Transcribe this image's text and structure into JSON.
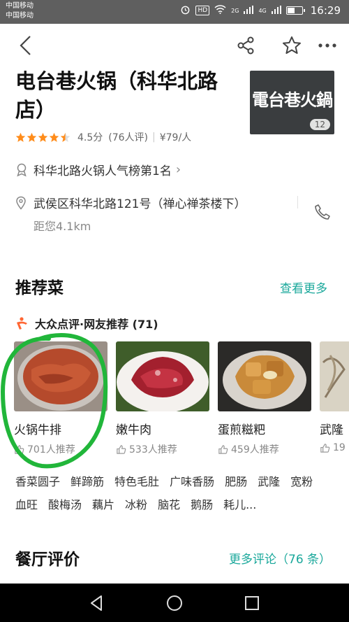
{
  "status": {
    "carrier_1": "中国移动",
    "carrier_2": "中国移动",
    "hd": "HD",
    "net_1": "2G",
    "net_2": "4G",
    "time": "16:29",
    "battery_level": 0.55
  },
  "nav": {
    "icons": [
      "back-arrow-icon",
      "share-icon",
      "star-outline-icon",
      "more-icon"
    ]
  },
  "shop": {
    "name": "电台巷火锅（科华北路店）",
    "thumb_text": "電台巷火鍋",
    "photo_count": "12",
    "star_rating": 4.5,
    "score": "4.5分",
    "reviews": "(76人评)",
    "price": "¥79/人",
    "rank": "科华北路火锅人气榜第1名",
    "address": "武侯区科华北路121号（禅心禅茶楼下）",
    "distance": "距您4.1km"
  },
  "recommend": {
    "title": "推荐菜",
    "more": "查看更多",
    "source": "大众点评·网友推荐 (71)",
    "dishes": [
      {
        "name": "火锅牛排",
        "rec": "701人推荐",
        "color": "#b54a2c"
      },
      {
        "name": "嫩牛肉",
        "rec": "533人推荐",
        "color": "#a3202e"
      },
      {
        "name": "蛋煎糍粑",
        "rec": "459人推荐",
        "color": "#c98a3a"
      },
      {
        "name": "武隆",
        "rec": "19",
        "color": "#d9d3c4"
      }
    ],
    "tags": [
      "香菜圆子",
      "鲜蹄筋",
      "特色毛肚",
      "广味香肠",
      "肥肠",
      "武隆",
      "宽粉",
      "血旺",
      "酸梅汤",
      "藕片",
      "冰粉",
      "脑花",
      "鹅肠",
      "耗儿..."
    ]
  },
  "reviews_section": {
    "title": "餐厅评价",
    "more": "更多评论（76 条）"
  },
  "colors": {
    "accent": "#1aa89b",
    "star": "#ff8c1a",
    "annotation": "#21b63a"
  }
}
